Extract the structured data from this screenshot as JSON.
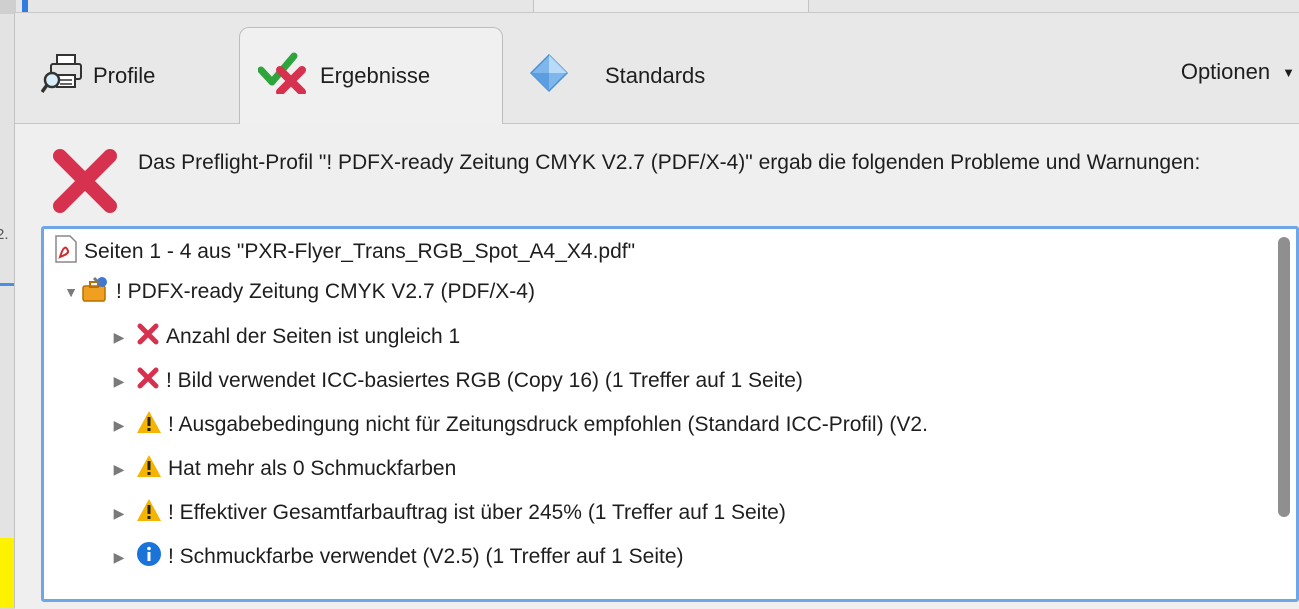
{
  "tabs": [
    {
      "label": "Profile",
      "icon": "magnifier-printer-icon"
    },
    {
      "label": "Ergebnisse",
      "icon": "check-cross-icon"
    },
    {
      "label": "Standards",
      "icon": "diamond-icon"
    }
  ],
  "options_label": "Optionen",
  "message": "Das Preflight-Profil \"! PDFX-ready Zeitung CMYK V2.7 (PDF/X-4)\" ergab die folgenden Probleme und Warnungen:",
  "tree": {
    "file": "Seiten 1 - 4 aus \"PXR-Flyer_Trans_RGB_Spot_A4_X4.pdf\"",
    "profile": "! PDFX-ready Zeitung CMYK V2.7 (PDF/X-4)",
    "items": [
      {
        "label": "Anzahl der Seiten ist ungleich 1",
        "icon": "error-icon"
      },
      {
        "label": "! Bild verwendet ICC-basiertes RGB (Copy 16) (1 Treffer auf 1 Seite)",
        "icon": "error-icon"
      },
      {
        "label": "! Ausgabebedingung nicht für Zeitungsdruck empfohlen (Standard ICC-Profil) (V2.",
        "icon": "warning-icon"
      },
      {
        "label": "Hat mehr als 0 Schmuckfarben",
        "icon": "warning-icon"
      },
      {
        "label": "! Effektiver Gesamtfarbauftrag ist über 245% (1 Treffer auf 1 Seite)",
        "icon": "warning-icon"
      },
      {
        "label": "! Schmuckfarbe verwendet (V2.5) (1 Treffer auf 1 Seite)",
        "icon": "info-icon"
      }
    ]
  },
  "background_fragment_text": "2.",
  "colors": {
    "error": "#d6324f",
    "warning": "#f5b400",
    "info": "#1a73d9",
    "focus": "#6fa6ea"
  }
}
